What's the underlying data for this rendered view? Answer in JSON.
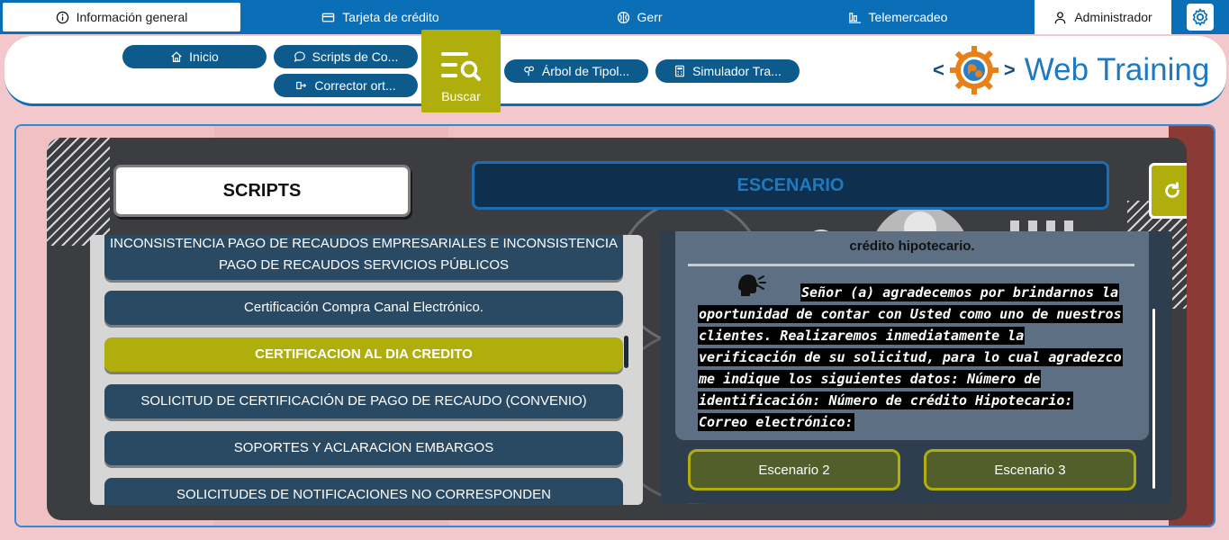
{
  "topnav": {
    "tabs": [
      {
        "label": "Información general",
        "icon": "info-icon"
      },
      {
        "label": "Tarjeta de crédito",
        "icon": "card-icon"
      },
      {
        "label": "Gerr",
        "icon": "brain-icon"
      },
      {
        "label": "Telemercadeo",
        "icon": "chart-icon"
      }
    ],
    "admin_label": "Administrador",
    "settings_icon": "gear-icon"
  },
  "toolbar": {
    "buttons": [
      {
        "label": "Inicio",
        "icon": "home-icon"
      },
      {
        "label": "Scripts de Co...",
        "icon": "chat-icon"
      },
      {
        "label": "Corrector ort...",
        "icon": "spell-icon"
      },
      {
        "label": "Árbol de Tipol...",
        "icon": "tree-icon"
      },
      {
        "label": "Simulador Tra...",
        "icon": "calculator-icon"
      }
    ],
    "search_label": "Buscar",
    "brand_left": "<",
    "brand_right": ">",
    "brand_name": "Web Training"
  },
  "main": {
    "scripts_title": "SCRIPTS",
    "escenario_title": "ESCENARIO",
    "list": [
      "INCONSISTENCIA PAGO DE RECAUDOS EMPRESARIALES E INCONSISTENCIA PAGO DE RECAUDOS SERVICIOS PÚBLICOS",
      "Certificación Compra Canal Electrónico.",
      "CERTIFICACION AL DIA CREDITO",
      "SOLICITUD DE CERTIFICACIÓN DE PAGO DE RECAUDO (CONVENIO)",
      "SOPORTES Y ACLARACION EMBARGOS",
      "SOLICITUDES DE NOTIFICACIONES NO CORRESPONDEN"
    ],
    "active_index": 2,
    "partial_title": "crédito hipotecario.",
    "script_text": "Señor (a) agradecemos por brindarnos la oportunidad de contar con Usted como uno de nuestros clientes. Realizaremos inmediatamente la verificación de su solicitud, para lo cual agradezco me indique los siguientes datos: Número de identificación: Número de crédito Hipotecario: Correo electrónico:",
    "scenario_buttons": [
      "Escenario 2",
      "Escenario 3"
    ]
  },
  "colors": {
    "primary": "#0b6fb8",
    "pill": "#0d5a8c",
    "accent": "#b0ae0d",
    "list_item": "#2a4962"
  }
}
